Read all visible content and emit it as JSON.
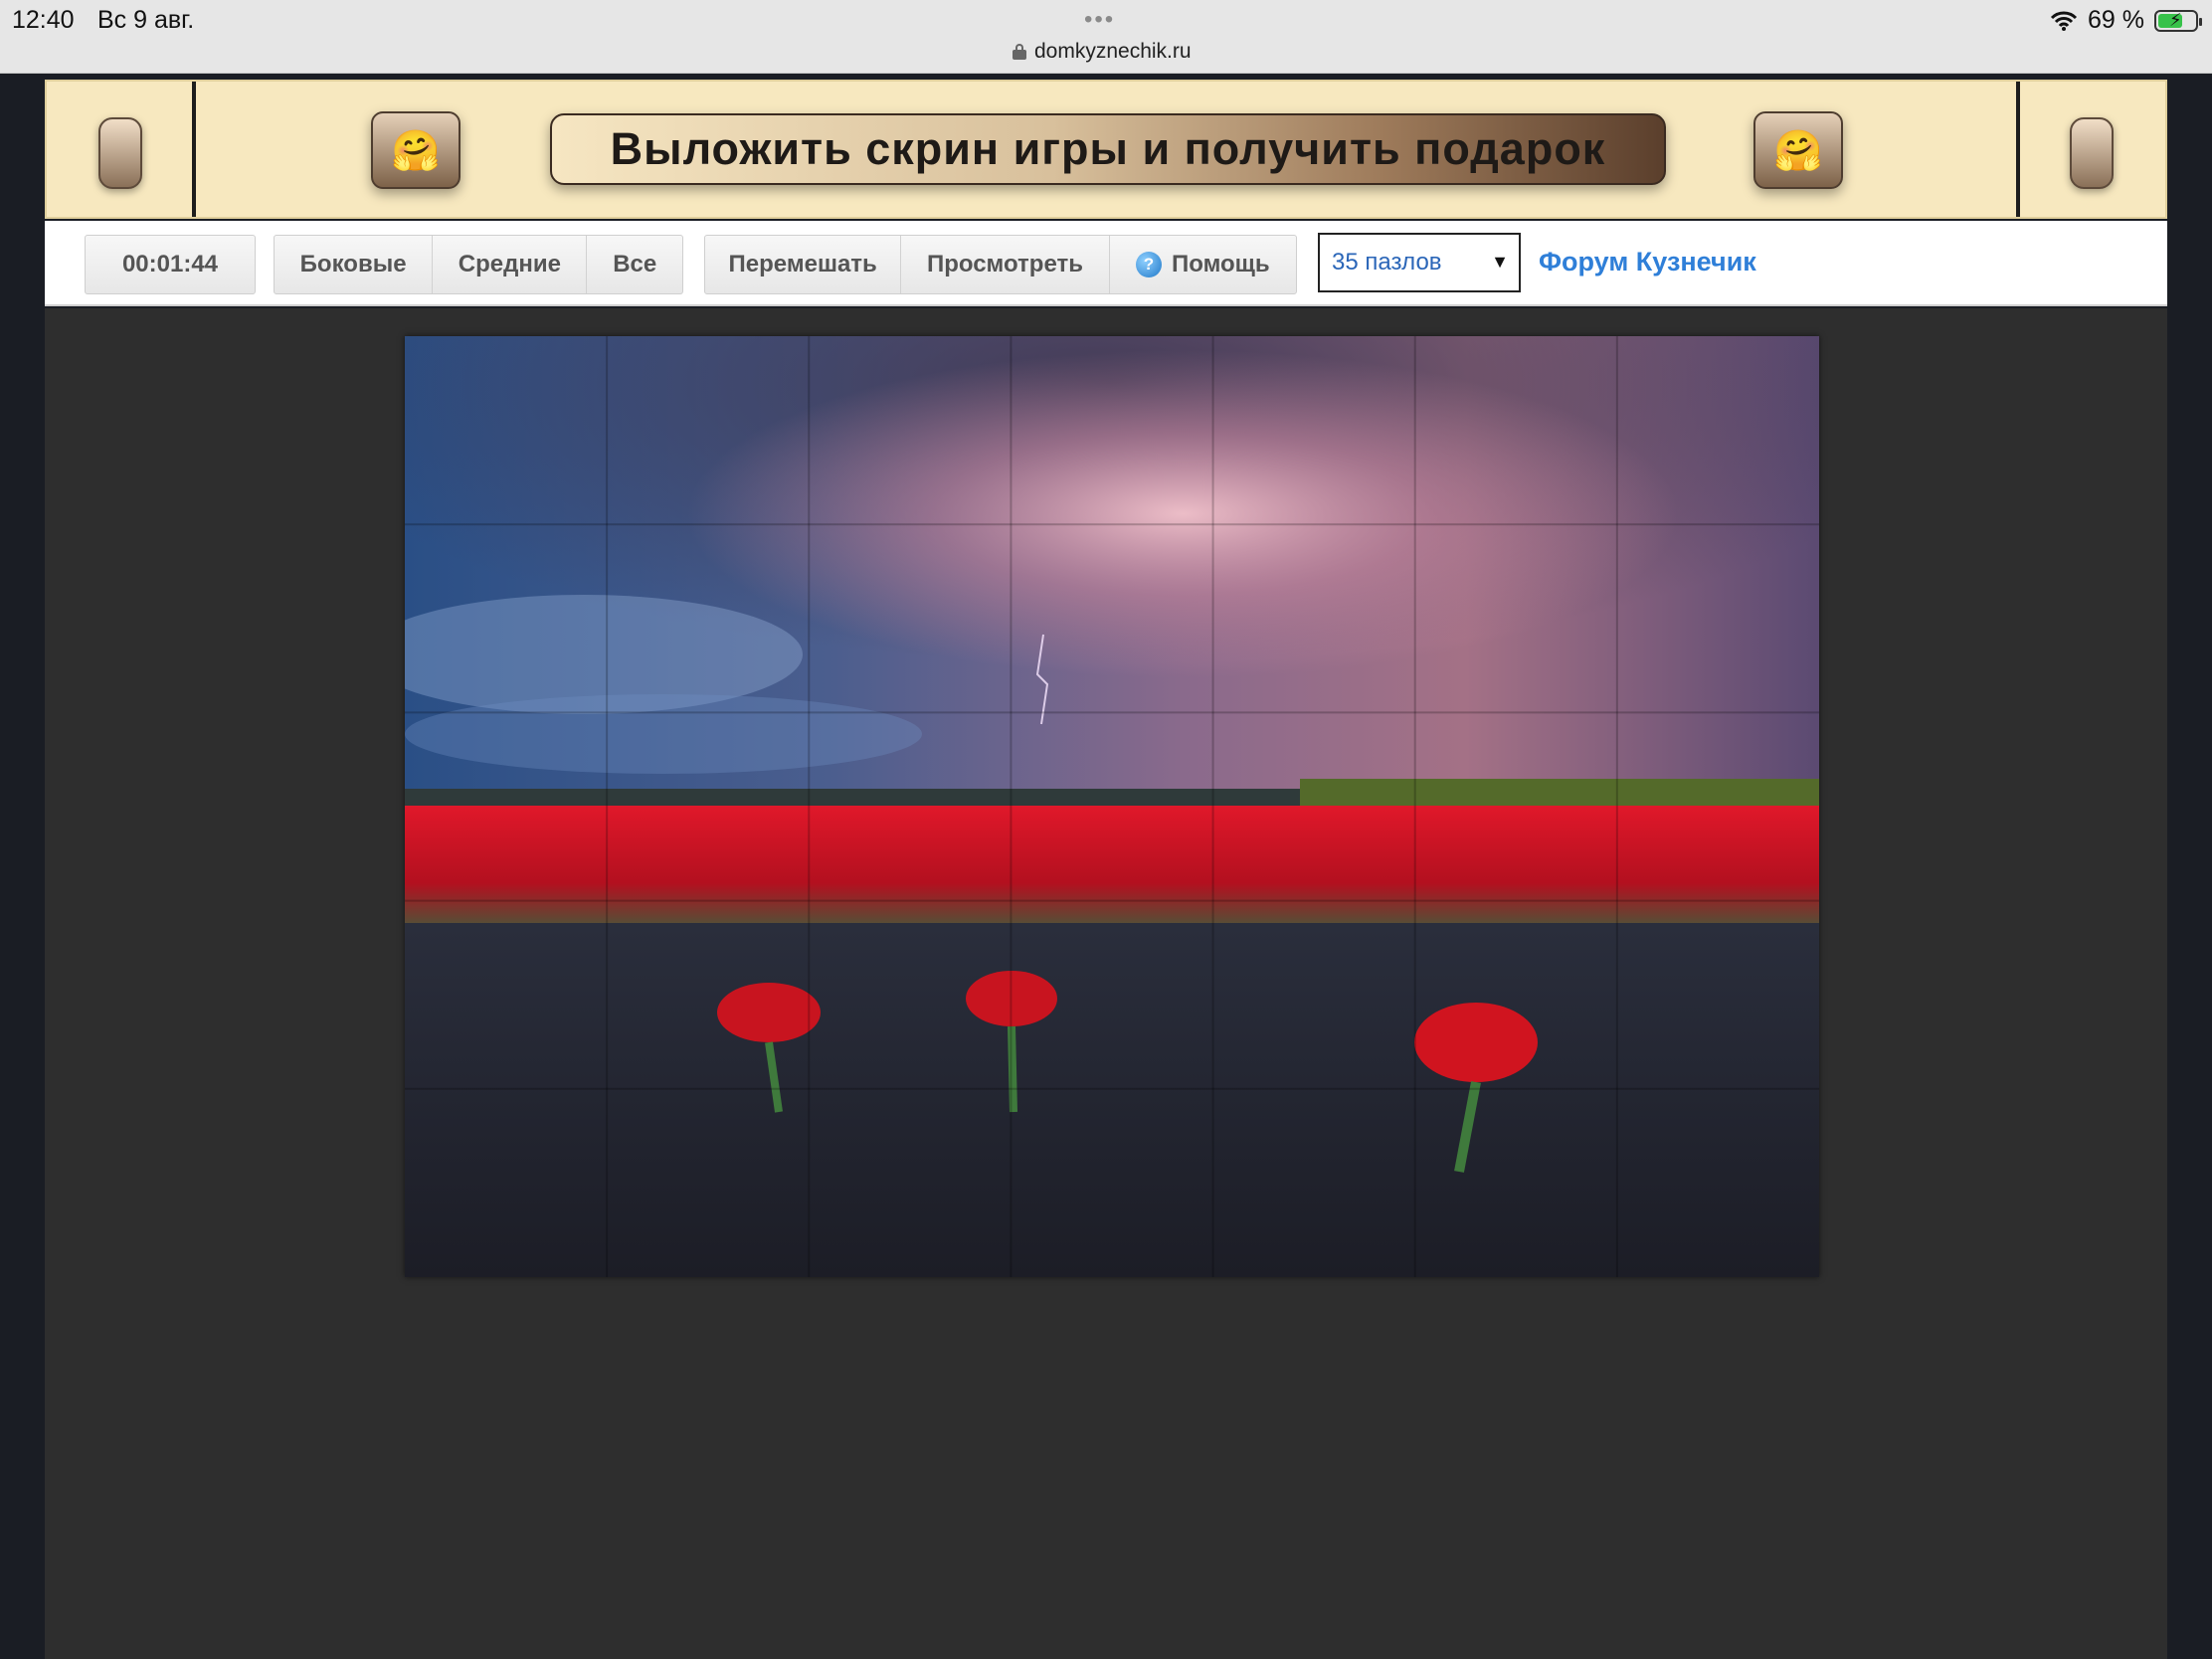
{
  "status_bar": {
    "time": "12:40",
    "date": "Вс 9 авг.",
    "dots": "•••",
    "url": "domkyznechik.ru",
    "battery": "69 %"
  },
  "banner": {
    "title": "Выложить скрин игры и получить подарок",
    "emoji": "🤗"
  },
  "toolbar": {
    "timer": "00:01:44",
    "filter_buttons": [
      "Боковые",
      "Средние",
      "Все"
    ],
    "action_buttons": {
      "shuffle": "Перемешать",
      "preview": "Просмотреть",
      "help": "Помощь"
    },
    "help_icon_glyph": "?",
    "pieces_select": {
      "value": "35 пазлов",
      "arrow": "▼"
    },
    "forum_link": "Форум Кузнечик"
  },
  "puzzle": {
    "columns": 7,
    "rows": 5
  },
  "colors": {
    "banner_bg": "#f7e8bf",
    "stage_bg": "#2e2e2e",
    "link": "#2f7fd8",
    "select_text": "#2b66b8"
  }
}
